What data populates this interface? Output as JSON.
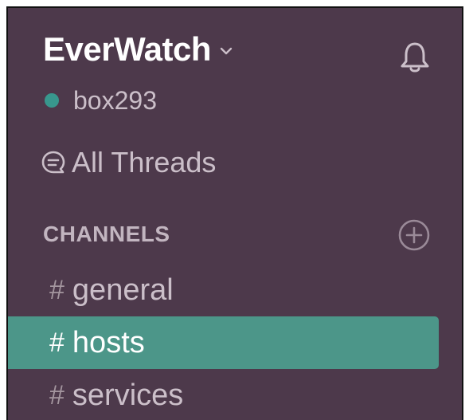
{
  "workspace": {
    "name": "EverWatch",
    "menu_icon": "chevron-down-icon",
    "notifications_icon": "bell-icon"
  },
  "user": {
    "name": "box293",
    "status": "online",
    "status_color": "#38978d"
  },
  "nav": {
    "all_threads_label": "All Threads",
    "all_threads_icon": "threads-icon"
  },
  "channels": {
    "header": "CHANNELS",
    "add_icon": "add-circle-icon",
    "items": [
      {
        "prefix": "#",
        "label": "general",
        "active": false
      },
      {
        "prefix": "#",
        "label": "hosts",
        "active": true
      },
      {
        "prefix": "#",
        "label": "services",
        "active": false
      }
    ]
  },
  "colors": {
    "sidebar_bg": "#4d394b",
    "active_item_bg": "#4c9689",
    "text_muted": "#cbbfc9",
    "text_active": "#ffffff"
  }
}
